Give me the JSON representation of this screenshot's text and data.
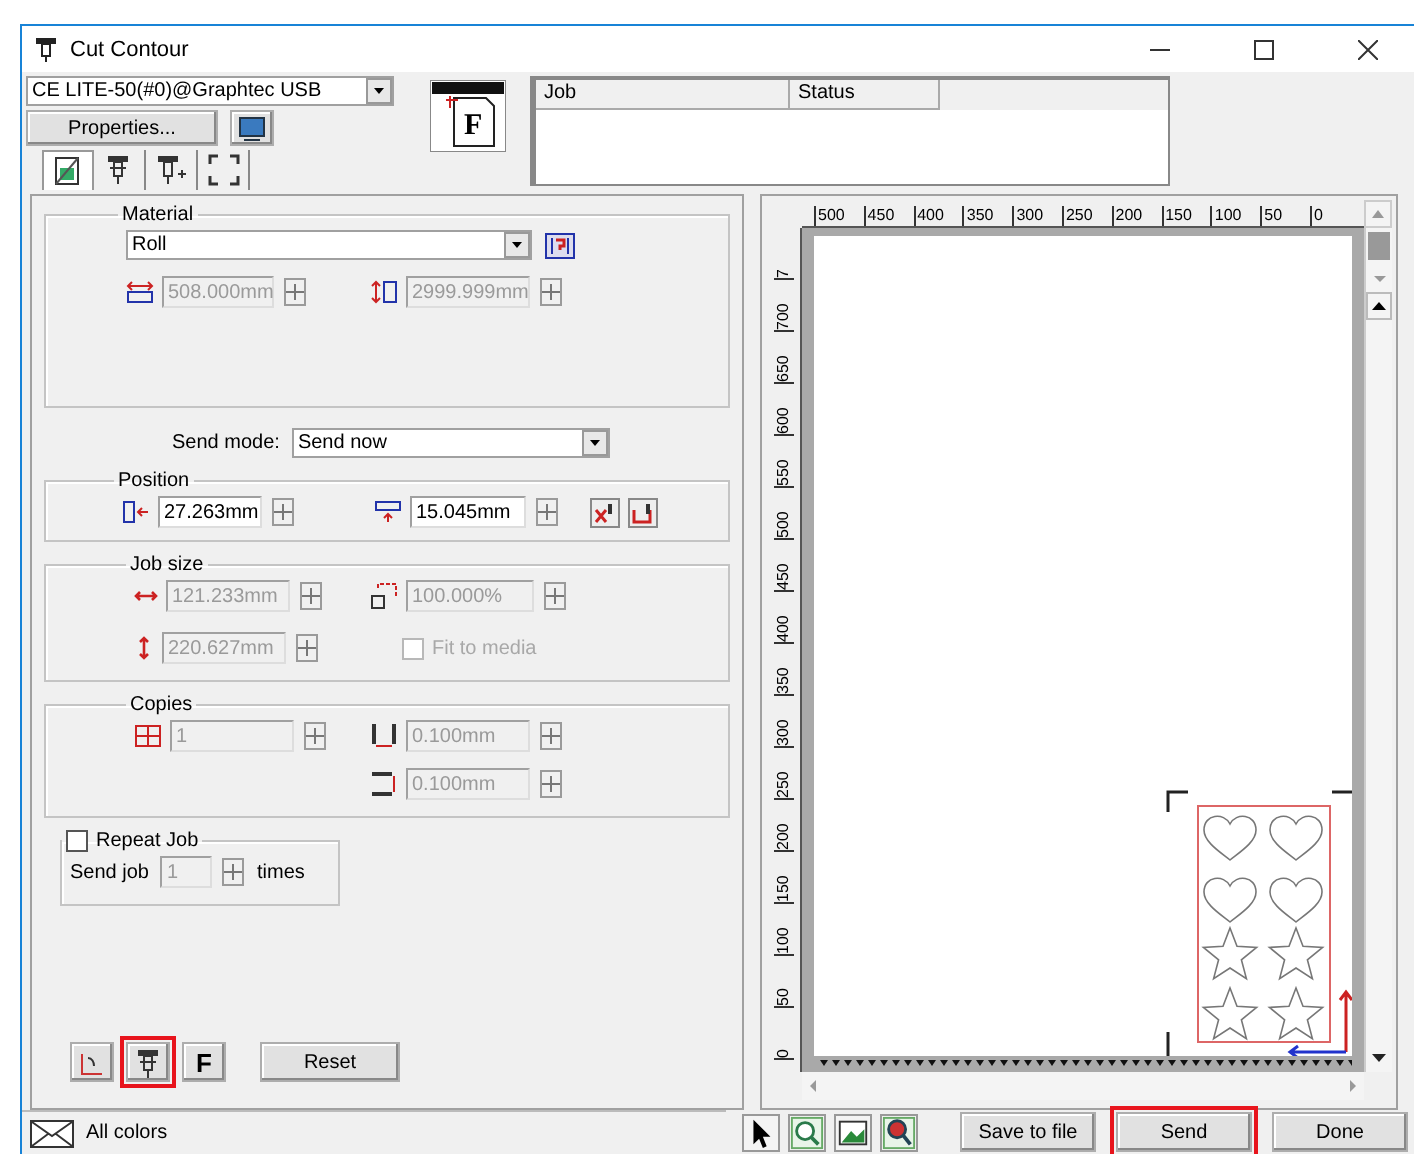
{
  "window": {
    "title": "Cut Contour"
  },
  "device": {
    "value": "CE LITE-50(#0)@Graphtec USB"
  },
  "properties_button": "Properties...",
  "tabs": [
    {
      "kind": "page",
      "selected": true
    },
    {
      "kind": "cutter",
      "selected": false
    },
    {
      "kind": "cutter-plus",
      "selected": false
    },
    {
      "kind": "frame",
      "selected": false
    }
  ],
  "job_preview": {
    "letter": "F"
  },
  "job_table": {
    "columns": [
      "Job",
      "Status"
    ]
  },
  "material": {
    "label": "Material",
    "media": "Roll",
    "width": {
      "value": "508.000mm",
      "disabled": true
    },
    "length": {
      "value": "2999.999mm",
      "disabled": true
    }
  },
  "send_mode": {
    "label": "Send mode:",
    "value": "Send now"
  },
  "position": {
    "label": "Position",
    "x": {
      "value": "27.263mm",
      "disabled": false
    },
    "y": {
      "value": "15.045mm",
      "disabled": false
    }
  },
  "job_size": {
    "label": "Job size",
    "width": {
      "value": "121.233mm",
      "disabled": true
    },
    "scale": {
      "value": "100.000%",
      "disabled": true
    },
    "height": {
      "value": "220.627mm",
      "disabled": true
    },
    "fit_to_media": {
      "label": "Fit to media",
      "checked": false,
      "disabled": true
    }
  },
  "copies": {
    "label": "Copies",
    "count": {
      "value": "1",
      "disabled": true
    },
    "spacing_x": {
      "value": "0.100mm",
      "disabled": true
    },
    "spacing_y": {
      "value": "0.100mm",
      "disabled": true
    }
  },
  "repeat_job": {
    "label": "Repeat Job",
    "checked": false,
    "send_job_label": "Send job",
    "times": {
      "value": "1",
      "disabled": true
    },
    "times_label": "times"
  },
  "bottom_tools": [
    {
      "kind": "weed",
      "highlighted": false
    },
    {
      "kind": "cutter",
      "highlighted": true
    },
    {
      "kind": "letter",
      "label": "F",
      "highlighted": false
    }
  ],
  "reset_button": "Reset",
  "status_bar": {
    "text": "All colors"
  },
  "preview": {
    "h_ruler": [
      "500",
      "450",
      "400",
      "350",
      "300",
      "250",
      "200",
      "150",
      "100",
      "50",
      "0"
    ],
    "v_ruler": [
      "7",
      "700",
      "650",
      "600",
      "550",
      "500",
      "450",
      "400",
      "350",
      "300",
      "250",
      "200",
      "150",
      "100",
      "50",
      "0"
    ]
  },
  "view_tools": [
    {
      "kind": "pointer"
    },
    {
      "kind": "zoom"
    },
    {
      "kind": "picture"
    },
    {
      "kind": "zoom-fit"
    }
  ],
  "actions": [
    {
      "label": "Save to file",
      "highlighted": false
    },
    {
      "label": "Send",
      "highlighted": true
    },
    {
      "label": "Done",
      "highlighted": false
    }
  ]
}
